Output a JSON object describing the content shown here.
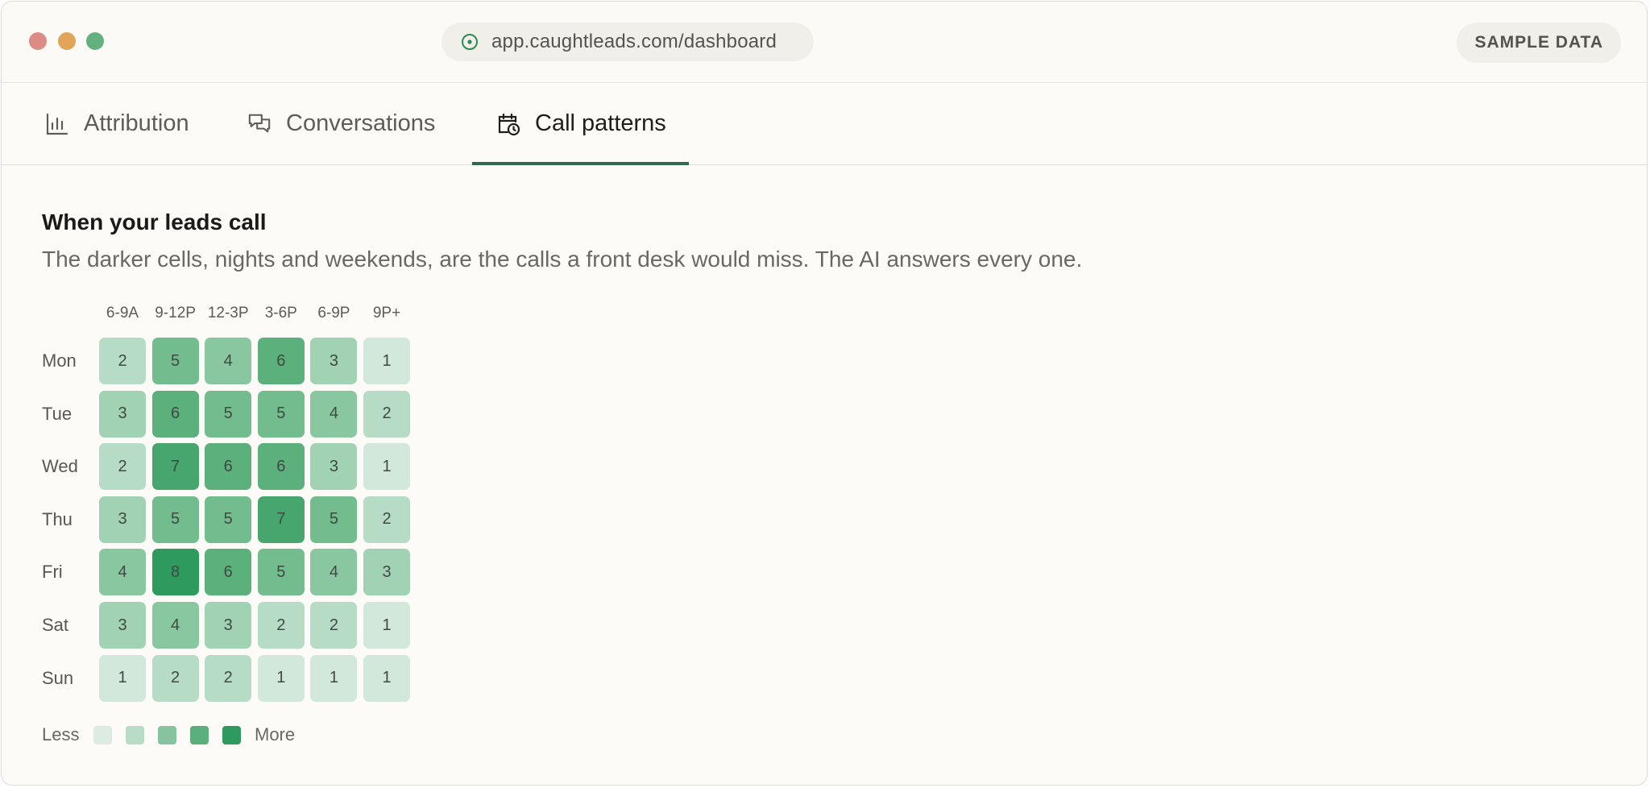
{
  "browser": {
    "url": "app.caughtleads.com/dashboard",
    "badge": "SAMPLE DATA"
  },
  "tabs": [
    {
      "label": "Attribution",
      "icon": "bar-chart-icon",
      "active": false
    },
    {
      "label": "Conversations",
      "icon": "chat-bubbles-icon",
      "active": false
    },
    {
      "label": "Call patterns",
      "icon": "calendar-clock-icon",
      "active": true
    }
  ],
  "section": {
    "title": "When your leads call",
    "subtitle": "The darker cells, nights and weekends, are the calls a front desk would miss. The AI answers every one."
  },
  "chart_data": {
    "type": "heatmap",
    "title": "",
    "columns": [
      "6-9A",
      "9-12P",
      "12-3P",
      "3-6P",
      "6-9P",
      "9P+"
    ],
    "rows": [
      "Mon",
      "Tue",
      "Wed",
      "Thu",
      "Fri",
      "Sat",
      "Sun"
    ],
    "values": [
      [
        2,
        5,
        4,
        6,
        3,
        1
      ],
      [
        3,
        6,
        5,
        5,
        4,
        2
      ],
      [
        2,
        7,
        6,
        6,
        3,
        1
      ],
      [
        3,
        5,
        5,
        7,
        5,
        2
      ],
      [
        4,
        8,
        6,
        5,
        4,
        3
      ],
      [
        3,
        4,
        3,
        2,
        2,
        1
      ],
      [
        1,
        2,
        2,
        1,
        1,
        1
      ]
    ],
    "color_scale": {
      "1": "#d1e8db",
      "2": "#b6dcc5",
      "3": "#a0d2b3",
      "4": "#88c7a0",
      "5": "#72bc8e",
      "6": "#5bb07c",
      "7": "#47a66d",
      "8": "#2f9a5d"
    },
    "legend": {
      "low_label": "Less",
      "high_label": "More",
      "swatches": [
        "#dcece2",
        "#b8dcc6",
        "#86c39e",
        "#5aaf7c",
        "#2f9a5d"
      ]
    }
  }
}
